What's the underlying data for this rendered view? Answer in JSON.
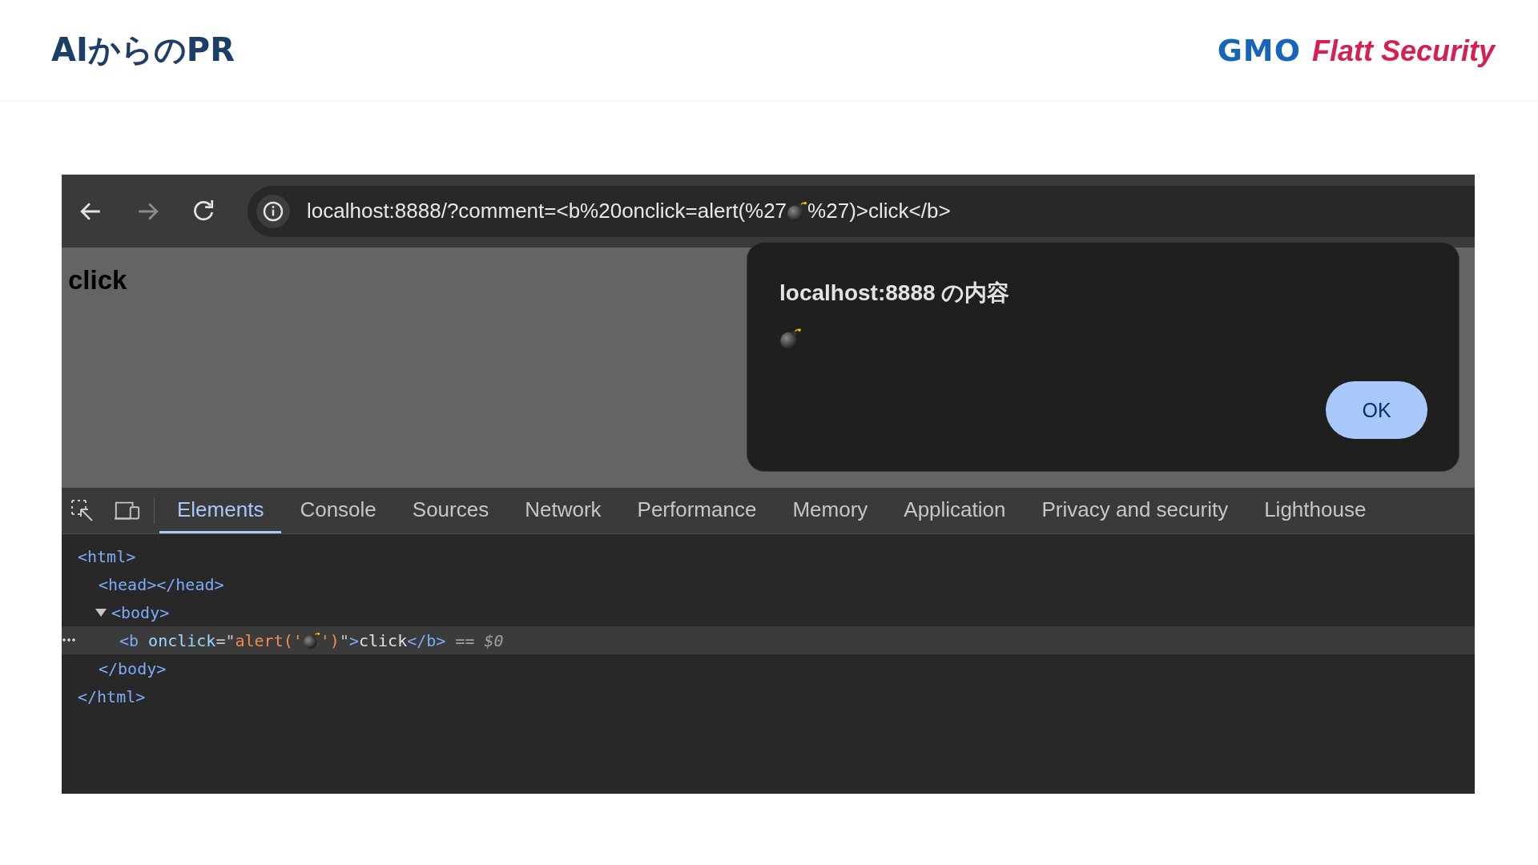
{
  "slide": {
    "title": "AIからのPR",
    "logo": {
      "mark": "GMO",
      "name": "Flatt Security"
    }
  },
  "browser": {
    "nav_buttons": [
      {
        "kind": "back",
        "disabled": false
      },
      {
        "kind": "forward",
        "disabled": true
      },
      {
        "kind": "reload",
        "disabled": false
      }
    ],
    "address": {
      "before": "localhost:8888/?comment=<b%20onclick=alert(%27",
      "after": " %27)>click</b>"
    },
    "page_text": "click",
    "dialog": {
      "title": "localhost:8888 の内容",
      "button": "OK"
    },
    "devtools": {
      "tabs": [
        {
          "label": "Elements",
          "selected": true
        },
        {
          "label": "Console",
          "selected": false
        },
        {
          "label": "Sources",
          "selected": false
        },
        {
          "label": "Network",
          "selected": false
        },
        {
          "label": "Performance",
          "selected": false
        },
        {
          "label": "Memory",
          "selected": false
        },
        {
          "label": "Application",
          "selected": false
        },
        {
          "label": "Privacy and security",
          "selected": false
        },
        {
          "label": "Lighthouse",
          "selected": false
        }
      ],
      "dom": [
        {
          "selected": false,
          "open": [
            {
              "kind": "tag",
              "text": "<html>"
            }
          ],
          "close": [
            {
              "kind": "tag",
              "text": "</html>"
            }
          ],
          "children": [
            {
              "selected": false,
              "open": [
                {
                  "kind": "tag",
                  "text": "<head></head>"
                }
              ]
            },
            {
              "selected": false,
              "expanded": true,
              "open": [
                {
                  "kind": "tag",
                  "text": "<body>"
                }
              ],
              "close": [
                {
                  "kind": "tag",
                  "text": "</body>"
                }
              ],
              "children": [
                {
                  "selected": true,
                  "open": [
                    {
                      "kind": "tag",
                      "text": "<b"
                    },
                    {
                      "kind": "attr",
                      "text": "onclick"
                    },
                    {
                      "kind": "punct",
                      "text": "=\""
                    },
                    {
                      "kind": "value",
                      "text": "alert('"
                    },
                    {
                      "kind": "bomb"
                    },
                    {
                      "kind": "value",
                      "text": "')"
                    },
                    {
                      "kind": "punct",
                      "text": "\""
                    },
                    {
                      "kind": "tag",
                      "text": ">"
                    },
                    {
                      "kind": "text",
                      "text": "click"
                    },
                    {
                      "kind": "tag",
                      "text": "</b>"
                    },
                    {
                      "kind": "ref",
                      "text": "== $0"
                    }
                  ]
                }
              ]
            }
          ]
        }
      ]
    }
  }
}
